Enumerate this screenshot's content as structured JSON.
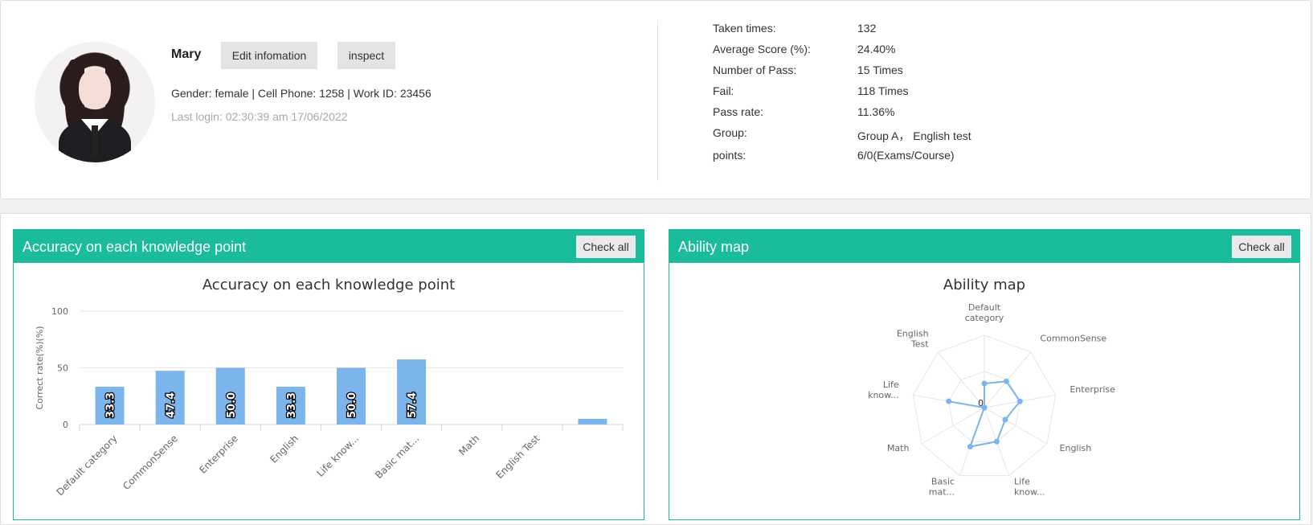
{
  "profile": {
    "name": "Mary",
    "edit_label": "Edit infomation",
    "inspect_label": "inspect",
    "info_line": "Gender:  female | Cell Phone:  1258 | Work ID:  23456",
    "last_login": "Last login:  02:30:39 am 17/06/2022"
  },
  "stats": [
    {
      "label": "Taken times:",
      "value": "132"
    },
    {
      "label": "Average Score (%):",
      "value": "24.40%"
    },
    {
      "label": "Number of Pass:",
      "value": "15 Times"
    },
    {
      "label": "Fail:",
      "value": "118 Times"
    },
    {
      "label": "Pass rate:",
      "value": "11.36%"
    },
    {
      "label": "Group:",
      "value": "Group A，  English test"
    },
    {
      "label": "points:",
      "value": "6/0(Exams/Course)"
    }
  ],
  "left_panel": {
    "header": "Accuracy on each knowledge point",
    "check_all": "Check all"
  },
  "right_panel": {
    "header": "Ability map",
    "check_all": "Check all"
  },
  "colors": {
    "accent": "#1abc9c",
    "bar": "#7cb5ec"
  },
  "chart_data": [
    {
      "type": "bar",
      "title": "Accuracy on each knowledge point",
      "ylabel": "Correct rate(%)(%)",
      "ylim": [
        0,
        100
      ],
      "yticks": [
        0,
        50,
        100
      ],
      "categories": [
        "Default category",
        "CommonSense",
        "Enterprise",
        "English",
        "Life know...",
        "Basic mat...",
        "Math",
        "English Test",
        ""
      ],
      "values": [
        33.3,
        47.4,
        50.0,
        33.3,
        50.0,
        57.4,
        0,
        0,
        5
      ],
      "labels": [
        "33.3",
        "47.4",
        "50.0",
        "33.3",
        "50.0",
        "57.4",
        "",
        "",
        ""
      ],
      "grid": true
    },
    {
      "type": "radar",
      "title": "Ability map",
      "axes": [
        "Default category",
        "CommonSense",
        "Enterprise",
        "English",
        "Life know...",
        "Basic mat...",
        "Math",
        "Life know...",
        "English Test"
      ],
      "values": [
        33.3,
        47.4,
        50.0,
        33.3,
        50.0,
        57.4,
        0,
        50.0,
        0
      ],
      "center_label": "0",
      "max": 100
    }
  ]
}
